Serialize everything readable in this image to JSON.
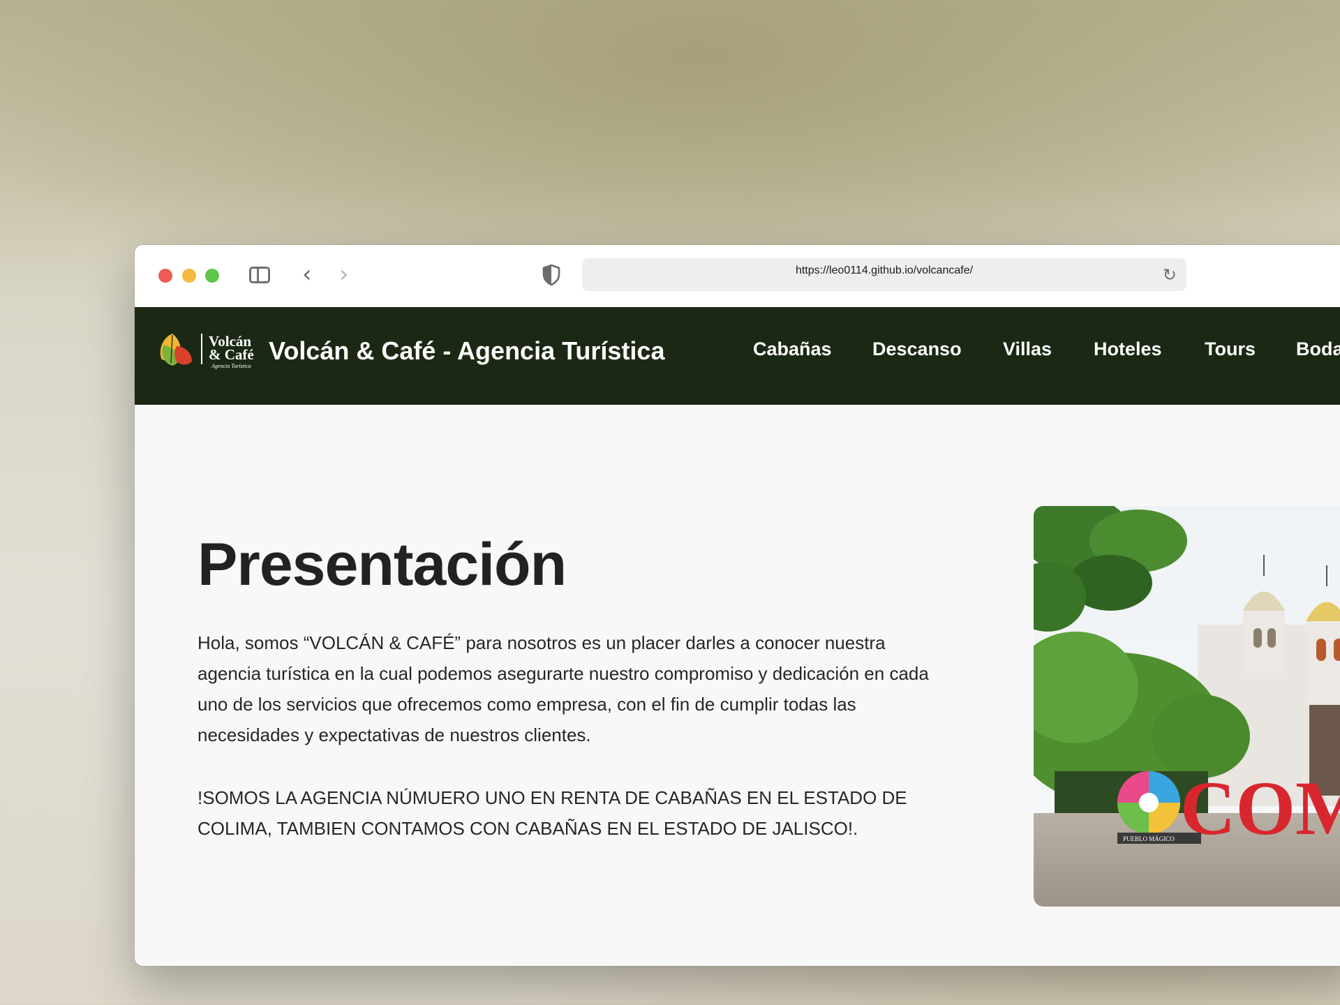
{
  "browser": {
    "url": "https://leo0114.github.io/volcancafe/"
  },
  "site": {
    "logo_text_line1": "Volcán",
    "logo_text_line2": "& Café",
    "logo_text_line3": "Agencia Turística",
    "brand": "Volcán & Café - Agencia Turística",
    "nav": [
      "Cabañas",
      "Descanso",
      "Villas",
      "Hoteles",
      "Tours",
      "Boda"
    ]
  },
  "main": {
    "heading": "Presentación",
    "paragraph1": "Hola, somos “VOLCÁN & CAFÉ” para nosotros es un placer darles a conocer nuestra agencia turística en la cual podemos asegurarte nuestro compromiso y dedicación en cada uno de los servicios que ofrecemos como empresa, con el fin de cumplir todas las necesidades y expectativas de nuestros clientes.",
    "paragraph2": "!SOMOS LA AGENCIA NÚMUERO UNO EN RENTA DE CABAÑAS EN EL ESTADO DE COLIMA, TAMBIEN CONTAMOS CON CABAÑAS EN EL ESTADO DE JALISCO!.",
    "photo_sign": "COM",
    "photo_sign_small": "PUEBLO MÁGICO"
  },
  "colors": {
    "header_bg": "#1b2914",
    "page_bg": "#f8f8f8"
  },
  "icons": [
    "sidebar-icon",
    "back-icon",
    "forward-icon",
    "shield-icon",
    "reload-icon"
  ]
}
